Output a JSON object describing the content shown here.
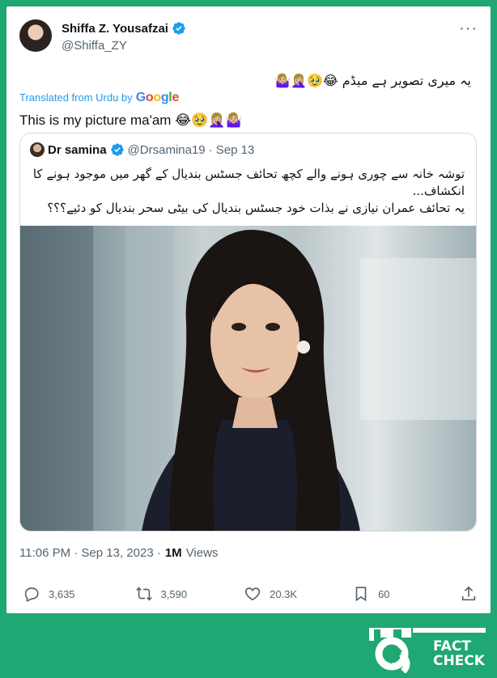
{
  "tweet": {
    "author_name": "Shiffa Z. Yousafzai",
    "author_handle": "@Shiffa_ZY",
    "more_label": "···",
    "text_urdu": "یہ میری تصویر ہے میڈم 😂🥹🤦🏼‍♀️🤷🏼‍♀️",
    "translated_from": "Translated from Urdu by",
    "translation_provider": "Google",
    "translation": "This is my picture ma'am 😂🥹🤦🏼‍♀️🤷🏼‍♀️",
    "timestamp": "11:06 PM · Sep 13, 2023 ·",
    "views_count": "1M",
    "views_label": "Views"
  },
  "quoted_tweet": {
    "author_name": "Dr samina",
    "author_handle": "@Drsamina19",
    "date": "· Sep 13",
    "text_line1": "توشہ خانہ سے چوری ہونے والے کچھ تحائف جسٹس بندیال کے گھر میں موجود ہونے کا انکشاف...",
    "text_line2": "یہ تحائف عمران نیازی نے بذات خود جسٹس بندیال کی بیٹی سحر بندیال کو دئیے؟؟؟"
  },
  "actions": {
    "replies": "3,635",
    "reposts": "3,590",
    "likes": "20.3K",
    "bookmarks": "60"
  },
  "watermark": {
    "line1": "FACT",
    "line2": "CHECK"
  },
  "colors": {
    "background": "#1fa774",
    "verified": "#1d9bf0",
    "secondary_text": "#536471"
  }
}
